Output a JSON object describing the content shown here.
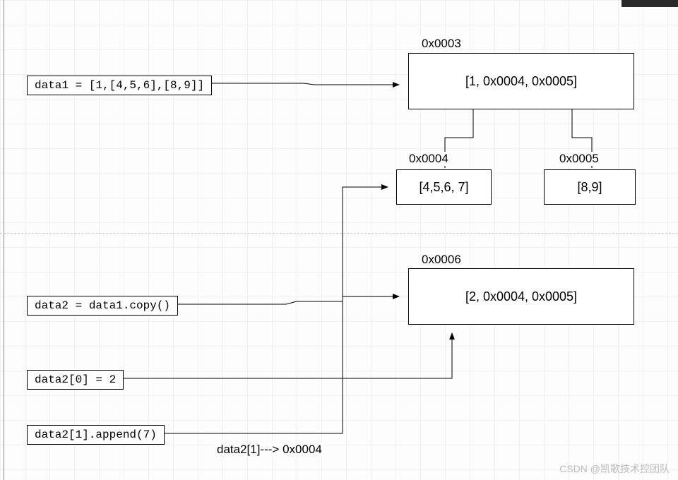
{
  "code": {
    "data1": "data1 = [1,[4,5,6],[8,9]]",
    "data2_copy": "data2 = data1.copy()",
    "data2_idx0": "data2[0] = 2",
    "data2_append": "data2[1].append(7)"
  },
  "addresses": {
    "box1": "0x0003",
    "box2": "0x0004",
    "box3": "0x0005",
    "box4": "0x0006"
  },
  "boxes": {
    "box1": "[1, 0x0004, 0x0005]",
    "box2": "[4,5,6, 7]",
    "box3": "[8,9]",
    "box4": "[2, 0x0004, 0x0005]"
  },
  "note": "data2[1]---> 0x0004",
  "watermark": "CSDN @凯歌技术控团队"
}
